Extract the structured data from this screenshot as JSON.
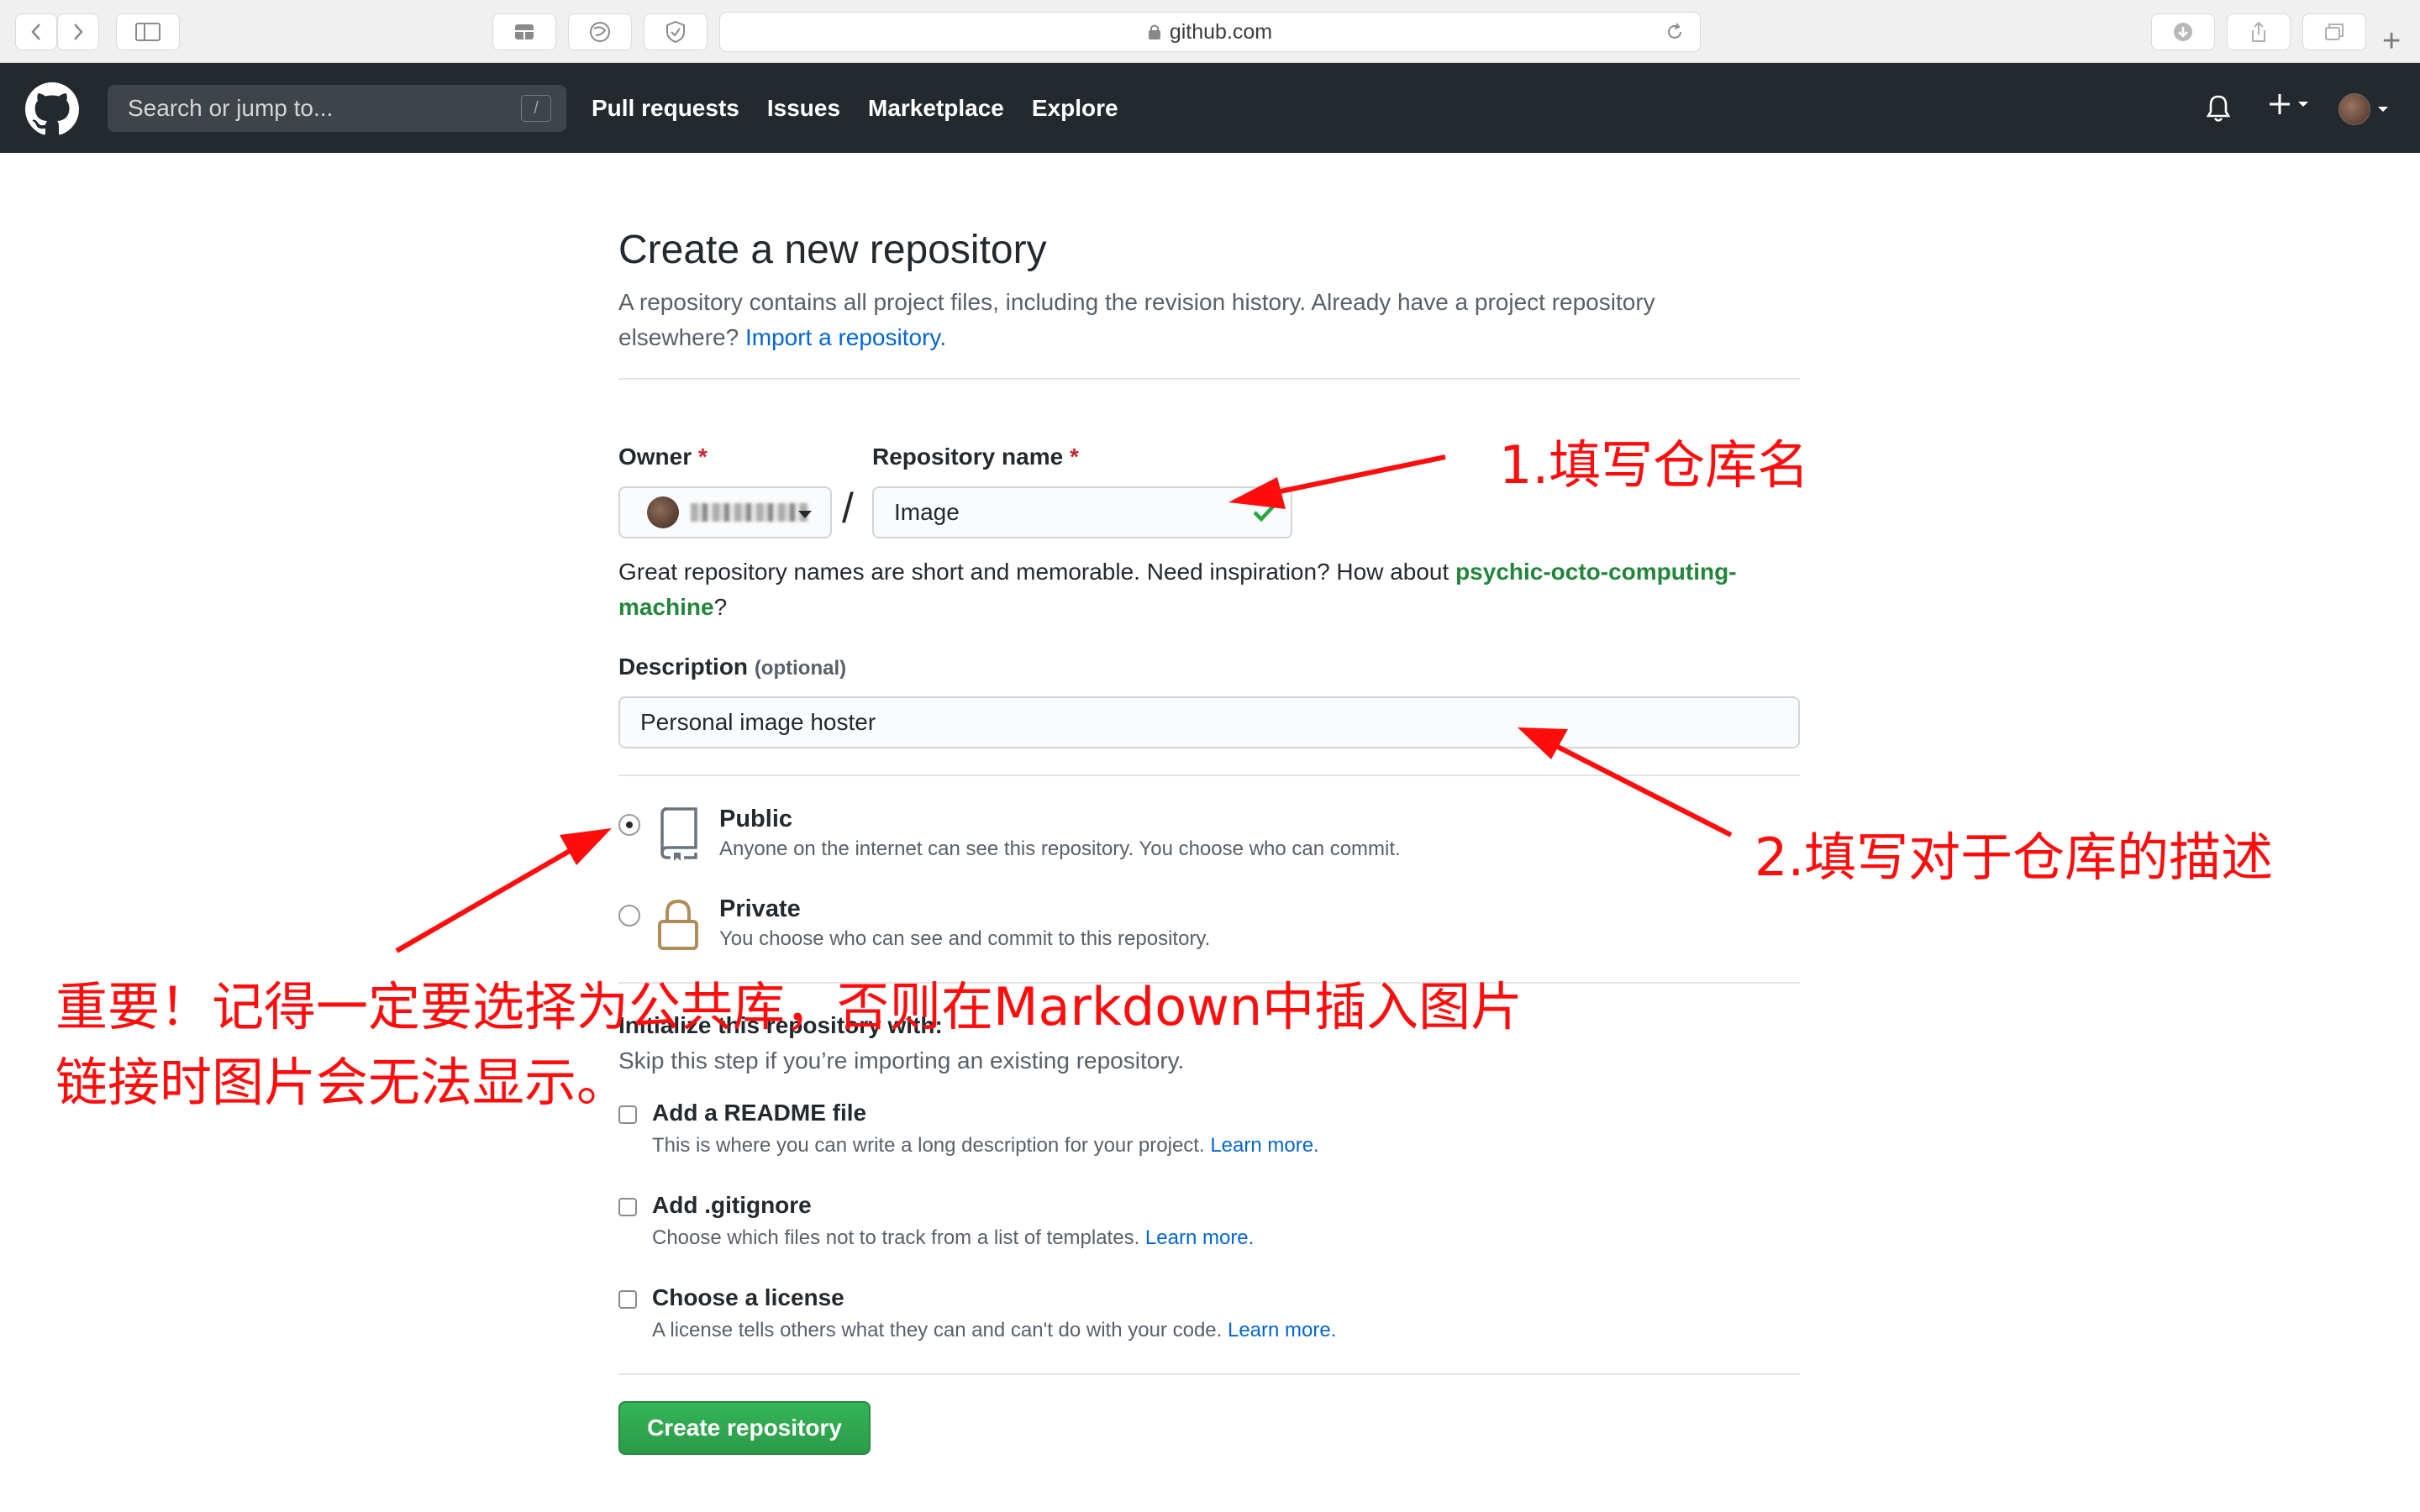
{
  "browser": {
    "url": "github.com"
  },
  "header": {
    "search_placeholder": "Search or jump to...",
    "search_shortcut": "/",
    "nav": [
      "Pull requests",
      "Issues",
      "Marketplace",
      "Explore"
    ]
  },
  "form": {
    "title": "Create a new repository",
    "subtitle_line1": "A repository contains all project files, including the revision history. Already have a project repository",
    "subtitle_line2": "elsewhere?",
    "import_link": "Import a repository.",
    "owner_label": "Owner",
    "required_mark": "*",
    "repo_name_label": "Repository name",
    "slash": "/",
    "repo_name_value": "Image",
    "hint_text": "Great repository names are short and memorable. Need inspiration? How about",
    "hint_suggestion_1": "psychic-octo-computing-",
    "hint_suggestion_2": "machine",
    "hint_end": "?",
    "description_label": "Description",
    "description_optional": "(optional)",
    "description_value": "Personal image hoster",
    "visibility": {
      "selected": "Public",
      "public_title": "Public",
      "public_note": "Anyone on the internet can see this repository. You choose who can commit.",
      "private_title": "Private",
      "private_note": "You choose who can see and commit to this repository."
    },
    "init_title": "Initialize this repository with:",
    "init_subtitle": "Skip this step if you’re importing an existing repository.",
    "readme_title": "Add a README file",
    "readme_note": "This is where you can write a long description for your project.",
    "gitignore_title": "Add .gitignore",
    "gitignore_note": "Choose which files not to track from a list of templates.",
    "license_title": "Choose a license",
    "license_note": "A license tells others what they can and can't do with your code.",
    "learn_more": "Learn more.",
    "create_button": "Create repository"
  },
  "annotations": {
    "step1": "1.填写仓库名",
    "step2": "2.填写对于仓库的描述",
    "important_line1": "重要！记得一定要选择为公共库，否则在Markdown中插入图片",
    "important_line2": "链接时图片会无法显示。",
    "color": "#ff0d0d"
  },
  "colors": {
    "header_bg": "#24292e",
    "link": "#0366d6",
    "suggestion": "#22863a",
    "button": "#2ea44f"
  }
}
